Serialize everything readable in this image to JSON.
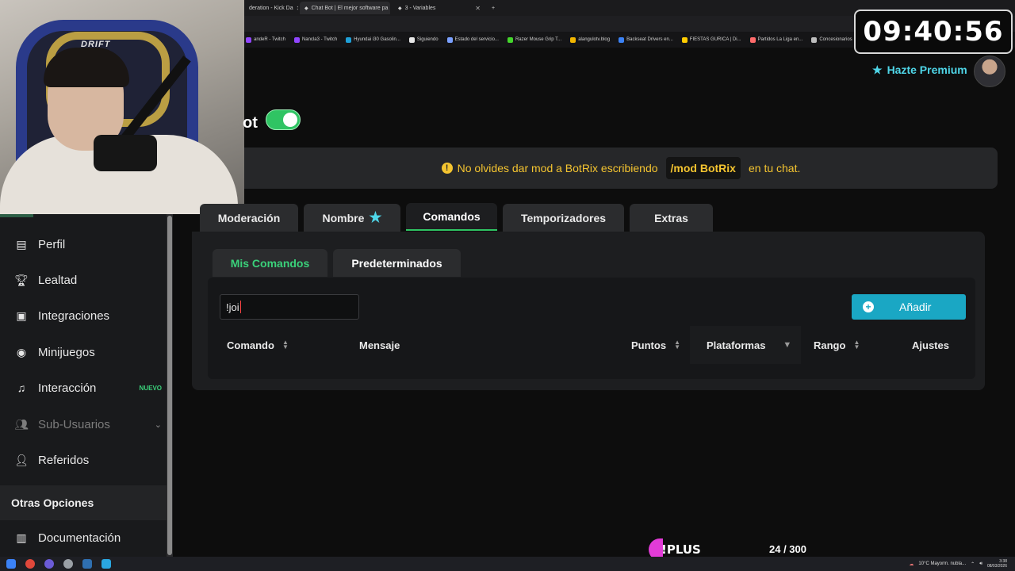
{
  "browser": {
    "tabs": [
      {
        "label": "deration - Kick Da",
        "active": false
      },
      {
        "label": "Chat Bot | El mejor software pa",
        "active": true
      },
      {
        "label": "3 - Variables",
        "active": false
      }
    ],
    "new_tab_label": "+",
    "bookmarks": [
      "andeR - Twitch",
      "Nancla3 - Twitch",
      "Hyundai i30 Gasolin...",
      "Siguiendo",
      "Estado del servicio...",
      "Razer Mouse Grip T...",
      "alangulotv.blog",
      "Backseat Drivers en...",
      "FIESTAS GURICA | Di...",
      "Partidos La Liga en...",
      "Concesionarios",
      "dolares"
    ]
  },
  "webcam": {
    "chair_brand": "DRIFT"
  },
  "clock": {
    "time": "09:40:56"
  },
  "header": {
    "premium_label": "Hazte Premium"
  },
  "page": {
    "title_fragment": "ot",
    "toggle_on": true
  },
  "alert": {
    "prefix": "No olvides dar mod a BotRix escribiendo",
    "command": "/mod BotRix",
    "suffix": "en tu chat."
  },
  "sidebar": {
    "items": [
      {
        "label": "Perfil",
        "icon": "id-card-icon"
      },
      {
        "label": "Lealtad",
        "icon": "trophy-icon"
      },
      {
        "label": "Integraciones",
        "icon": "square-dot-icon"
      },
      {
        "label": "Minijuegos",
        "icon": "gamepad-icon"
      },
      {
        "label": "Interacción",
        "icon": "music-note-icon",
        "badge": "NUEVO"
      },
      {
        "label": "Sub-Usuarios",
        "icon": "users-icon",
        "disabled": true
      },
      {
        "label": "Referidos",
        "icon": "user-plus-icon"
      }
    ],
    "section_title": "Otras Opciones",
    "doc_item": {
      "label": "Documentación",
      "icon": "book-icon"
    }
  },
  "main_tabs": [
    "Moderación",
    "Nombre",
    "Comandos",
    "Temporizadores",
    "Extras"
  ],
  "active_main_tab": "Comandos",
  "sub_tabs": [
    "Mis Comandos",
    "Predeterminados"
  ],
  "search": {
    "value": "!joi"
  },
  "add_button": {
    "label": "Añadir"
  },
  "table": {
    "columns": [
      "Comando",
      "Mensaje",
      "Puntos",
      "Plataformas",
      "Rango",
      "Ajustes"
    ]
  },
  "overlay": {
    "plus_label": "!PLUS",
    "counter": "24 / 300"
  },
  "taskbar": {
    "weather": "10°C  Mayorm. nubla...",
    "time": "3:38",
    "date": "08/03/2026"
  },
  "colors": {
    "accent_green": "#2fc463",
    "accent_cyan": "#1aa7c4",
    "warning_yellow": "#f4c430",
    "plus_pink": "#e23bd7"
  }
}
